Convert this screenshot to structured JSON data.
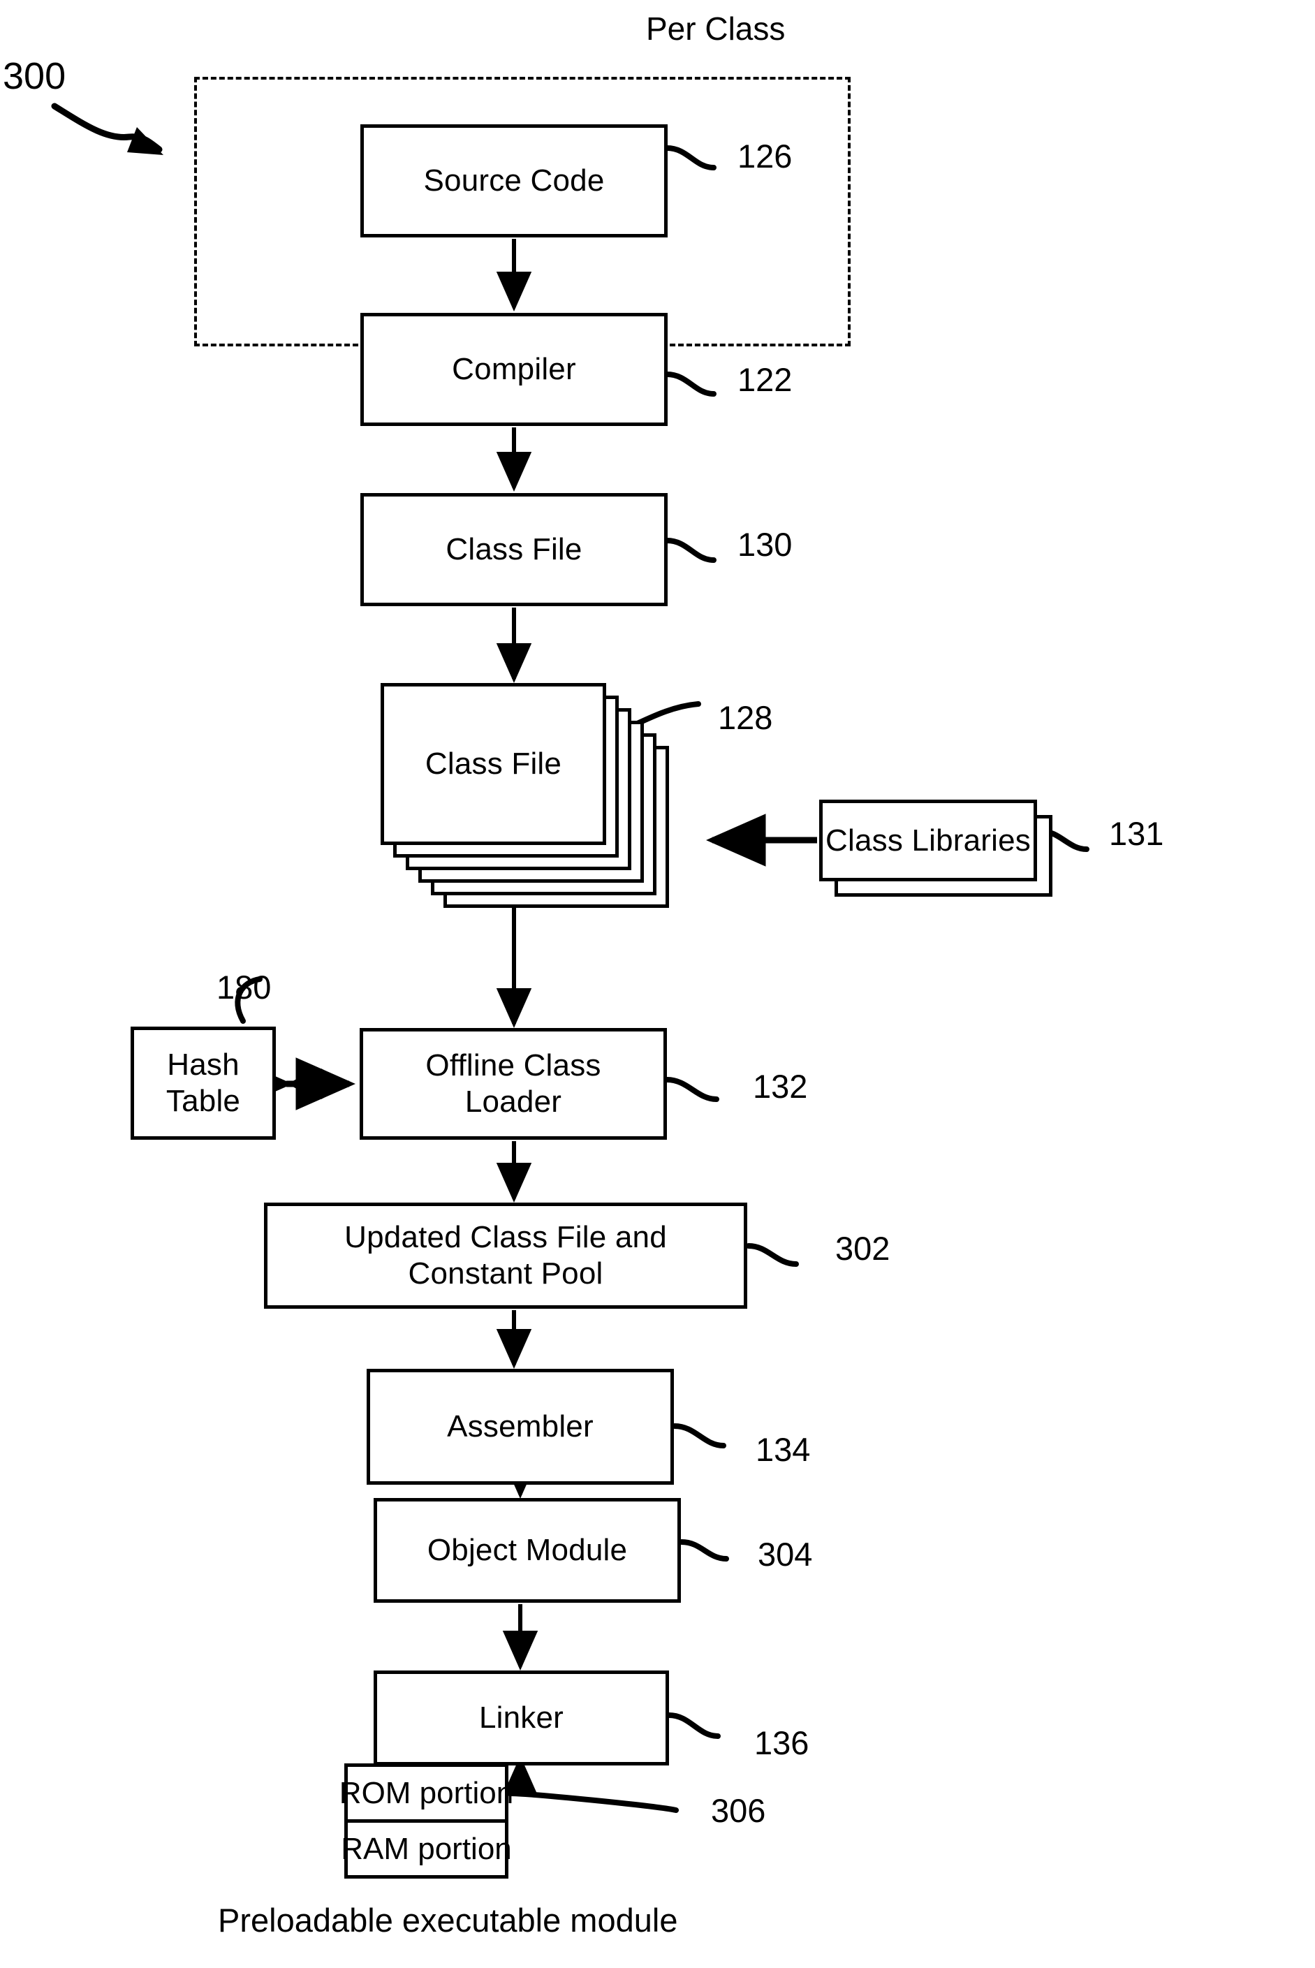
{
  "figure": {
    "figure_ref": "300",
    "group_label": "Per Class",
    "caption": "Preloadable executable module"
  },
  "nodes": {
    "source_code": {
      "label": "Source Code",
      "ref": "126"
    },
    "compiler": {
      "label": "Compiler",
      "ref": "122"
    },
    "class_file_1": {
      "label": "Class File",
      "ref": "130"
    },
    "class_file_stack": {
      "label": "Class File",
      "ref": "128"
    },
    "class_libraries": {
      "label": "Class Libraries",
      "ref": "131"
    },
    "hash_table": {
      "label_line1": "Hash",
      "label_line2": "Table",
      "ref": "180"
    },
    "offline_class_loader": {
      "label_line1": "Offline Class",
      "label_line2": "Loader",
      "ref": "132"
    },
    "updated_class_file": {
      "label_line1": "Updated Class File and",
      "label_line2": "Constant Pool",
      "ref": "302"
    },
    "assembler": {
      "label": "Assembler",
      "ref": "134"
    },
    "object_module": {
      "label": "Object Module",
      "ref": "304"
    },
    "linker": {
      "label": "Linker",
      "ref": "136"
    },
    "executable": {
      "rom_label": "ROM portion",
      "ram_label": "RAM portion",
      "ref": "306"
    }
  },
  "colors": {
    "ink": "#000000",
    "paper": "#ffffff"
  }
}
